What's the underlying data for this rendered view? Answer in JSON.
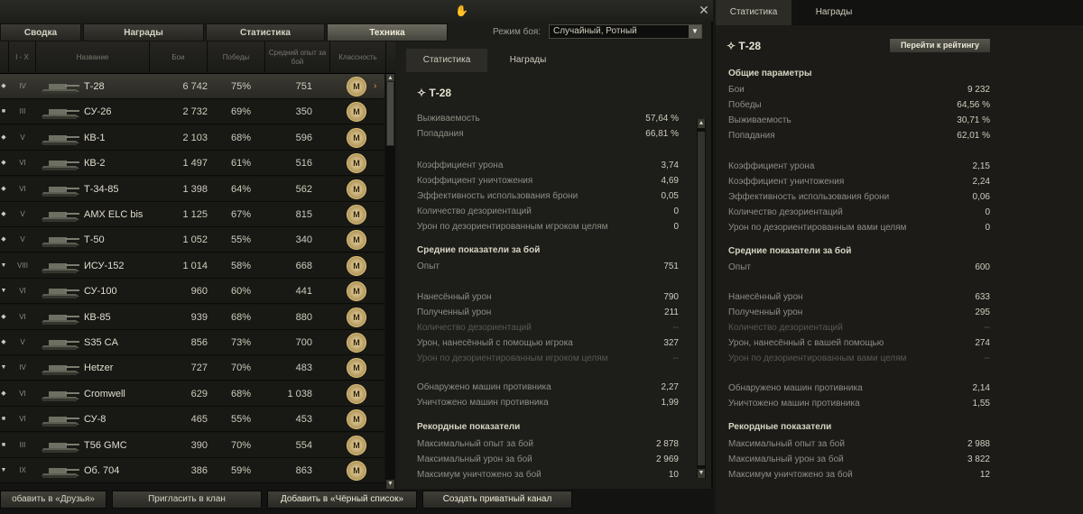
{
  "main_tabs": [
    "Сводка",
    "Награды",
    "Статистика",
    "Техника"
  ],
  "mode": {
    "label": "Режим боя:",
    "value": "Случайный, Ротный"
  },
  "table": {
    "headers": {
      "level": "I - X",
      "name": "Название",
      "battles": "Бои",
      "wins": "Победы",
      "avg_exp": "Средний опыт за бой",
      "mastery": "Классность"
    },
    "mastery_mark": "M",
    "rows": [
      {
        "type": "◆",
        "level": "IV",
        "name": "Т-28",
        "battles": "6 742",
        "wins": "75%",
        "exp": "751",
        "selected": true
      },
      {
        "type": "■",
        "level": "III",
        "name": "СУ-26",
        "battles": "2 732",
        "wins": "69%",
        "exp": "350"
      },
      {
        "type": "◆",
        "level": "V",
        "name": "КВ-1",
        "battles": "2 103",
        "wins": "68%",
        "exp": "596"
      },
      {
        "type": "◆",
        "level": "VI",
        "name": "КВ-2",
        "battles": "1 497",
        "wins": "61%",
        "exp": "516"
      },
      {
        "type": "◆",
        "level": "VI",
        "name": "Т-34-85",
        "battles": "1 398",
        "wins": "64%",
        "exp": "562"
      },
      {
        "type": "◆",
        "level": "V",
        "name": "AMX ELC bis",
        "battles": "1 125",
        "wins": "67%",
        "exp": "815"
      },
      {
        "type": "◆",
        "level": "V",
        "name": "Т-50",
        "battles": "1 052",
        "wins": "55%",
        "exp": "340"
      },
      {
        "type": "▼",
        "level": "VIII",
        "name": "ИСУ-152",
        "battles": "1 014",
        "wins": "58%",
        "exp": "668"
      },
      {
        "type": "▼",
        "level": "VI",
        "name": "СУ-100",
        "battles": "960",
        "wins": "60%",
        "exp": "441"
      },
      {
        "type": "◆",
        "level": "VI",
        "name": "КВ-85",
        "battles": "939",
        "wins": "68%",
        "exp": "880"
      },
      {
        "type": "◆",
        "level": "V",
        "name": "S35 CA",
        "battles": "856",
        "wins": "73%",
        "exp": "700"
      },
      {
        "type": "▼",
        "level": "IV",
        "name": "Hetzer",
        "battles": "727",
        "wins": "70%",
        "exp": "483"
      },
      {
        "type": "◆",
        "level": "VI",
        "name": "Cromwell",
        "battles": "629",
        "wins": "68%",
        "exp": "1 038"
      },
      {
        "type": "■",
        "level": "VI",
        "name": "СУ-8",
        "battles": "465",
        "wins": "55%",
        "exp": "453"
      },
      {
        "type": "■",
        "level": "III",
        "name": "T56 GMC",
        "battles": "390",
        "wins": "70%",
        "exp": "554"
      },
      {
        "type": "▼",
        "level": "IX",
        "name": "Об. 704",
        "battles": "386",
        "wins": "59%",
        "exp": "863"
      }
    ]
  },
  "center": {
    "tabs": [
      "Статистика",
      "Награды"
    ],
    "title": "Т-28",
    "rows": [
      {
        "label": "Выживаемость",
        "value": "57,64 %"
      },
      {
        "label": "Попадания",
        "value": "66,81 %"
      },
      {
        "label": "Коэффициент урона",
        "value": "3,74"
      },
      {
        "label": "Коэффициент уничтожения",
        "value": "4,69"
      },
      {
        "label": "Эффективность использования брони",
        "value": "0,05"
      },
      {
        "label": "Количество дезориентаций",
        "value": "0"
      },
      {
        "label": "Урон по дезориентированным игроком целям",
        "value": "0"
      },
      {
        "label": "Опыт",
        "value": "751"
      },
      {
        "label": "Нанесённый урон",
        "value": "790"
      },
      {
        "label": "Полученный урон",
        "value": "211"
      },
      {
        "label": "Количество дезориентаций",
        "value": "--"
      },
      {
        "label": "Урон, нанесённый с помощью игрока",
        "value": "327"
      },
      {
        "label": "Урон по дезориентированным игроком целям",
        "value": "--"
      },
      {
        "label": "Обнаружено машин противника",
        "value": "2,27"
      },
      {
        "label": "Уничтожено машин противника",
        "value": "1,99"
      },
      {
        "label": "Максимальный опыт за бой",
        "value": "2 878"
      },
      {
        "label": "Максимальный урон за бой",
        "value": "2 969"
      },
      {
        "label": "Максимум уничтожено за бой",
        "value": "10"
      }
    ],
    "section_avg": "Средние показатели за бой",
    "section_rec": "Рекордные показатели"
  },
  "right": {
    "tabs": [
      "Статистика",
      "Награды"
    ],
    "title": "Т-28",
    "rank_button": "Перейти к рейтингу",
    "section_general": "Общие параметры",
    "section_avg": "Средние показатели за бой",
    "section_rec": "Рекордные показатели",
    "rows": [
      {
        "label": "Бои",
        "value": "9 232"
      },
      {
        "label": "Победы",
        "value": "64,56 %"
      },
      {
        "label": "Выживаемость",
        "value": "30,71 %"
      },
      {
        "label": "Попадания",
        "value": "62,01 %"
      },
      {
        "label": "Коэффициент урона",
        "value": "2,15"
      },
      {
        "label": "Коэффициент уничтожения",
        "value": "2,24"
      },
      {
        "label": "Эффективность использования брони",
        "value": "0,06"
      },
      {
        "label": "Количество дезориентаций",
        "value": "0"
      },
      {
        "label": "Урон по дезориентированным вами целям",
        "value": "0"
      },
      {
        "label": "Опыт",
        "value": "600"
      },
      {
        "label": "Нанесённый урон",
        "value": "633"
      },
      {
        "label": "Полученный урон",
        "value": "295"
      },
      {
        "label": "Количество дезориентаций",
        "value": "--"
      },
      {
        "label": "Урон, нанесённый с вашей помощью",
        "value": "274"
      },
      {
        "label": "Урон по дезориентированным вами целям",
        "value": "--"
      },
      {
        "label": "Обнаружено машин противника",
        "value": "2,14"
      },
      {
        "label": "Уничтожено машин противника",
        "value": "1,55"
      },
      {
        "label": "Максимальный опыт за бой",
        "value": "2 988"
      },
      {
        "label": "Максимальный урон за бой",
        "value": "3 822"
      },
      {
        "label": "Максимум уничтожено за бой",
        "value": "12"
      }
    ]
  },
  "bottom_buttons": [
    "обавить в «Друзья»",
    "Пригласить в клан",
    "Добавить в «Чёрный список»",
    "Создать приватный канал"
  ]
}
